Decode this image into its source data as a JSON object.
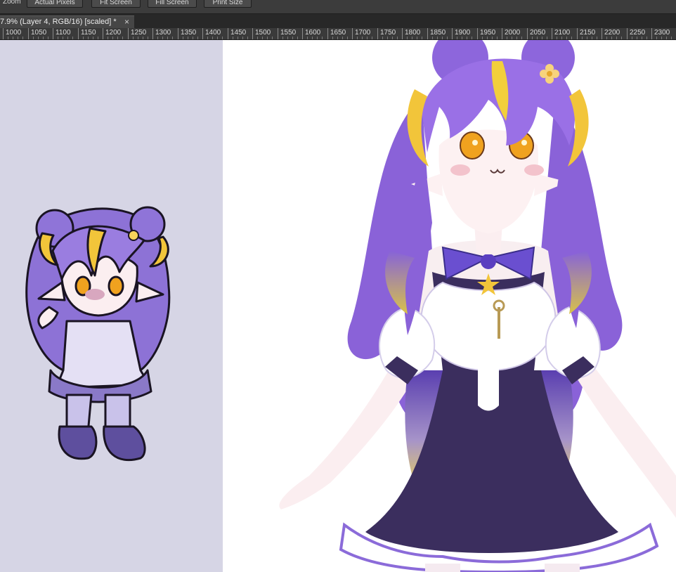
{
  "options_bar": {
    "zoom_label": "Zoom",
    "actual_pixels": "Actual Pixels",
    "fit_screen": "Fit Screen",
    "fill_screen": "Fill Screen",
    "print_size": "Print Size"
  },
  "document_tab": {
    "title": "7.9% (Layer 4, RGB/16) [scaled] *",
    "close_glyph": "×"
  },
  "ruler": {
    "labels": [
      "1000",
      "1050",
      "1100",
      "1150",
      "1200",
      "1250",
      "1300",
      "1350",
      "1400",
      "1450",
      "1500",
      "1550",
      "1600",
      "1650",
      "1700",
      "1750",
      "1800",
      "1850",
      "1900",
      "1950",
      "2000",
      "2050",
      "2100",
      "2150",
      "2200",
      "2250",
      "2300"
    ]
  },
  "colors": {
    "hair_purple": "#8b6bd9",
    "hair_yellow": "#f2c53a",
    "dress_dark": "#3b2e5e",
    "left_bg": "#d6d5e5"
  }
}
